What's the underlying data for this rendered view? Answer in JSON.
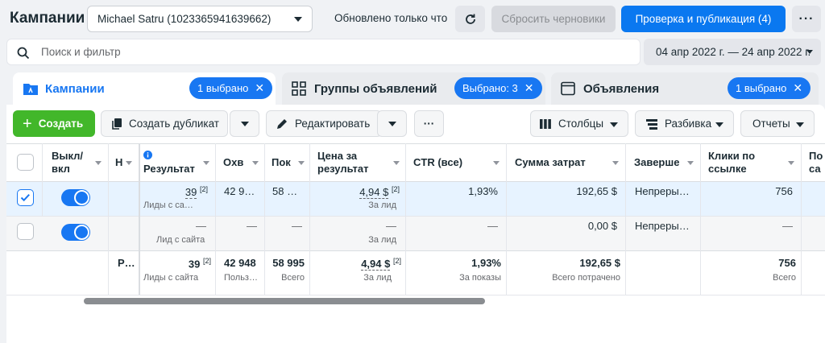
{
  "header": {
    "title": "Кампании",
    "account": "Michael Satru (1023365941639662)",
    "updated": "Обновлено только что",
    "discard_label": "Сбросить черновики",
    "publish_label": "Проверка и публикация (4)",
    "more_label": "···"
  },
  "search": {
    "placeholder": "Поиск и фильтр"
  },
  "date_range": "04 апр 2022 г. — 24 апр 2022 г.",
  "tabs": [
    {
      "label": "Кампании",
      "badge": "1 выбрано"
    },
    {
      "label": "Группы объявлений",
      "badge": "Выбрано: 3"
    },
    {
      "label": "Объявления",
      "badge": "1 выбрано"
    }
  ],
  "toolbar": {
    "create": "Создать",
    "duplicate": "Создать дубликат",
    "edit": "Редактировать",
    "more": "···",
    "columns": "Столбцы",
    "breakdown": "Разбивка",
    "reports": "Отчеты"
  },
  "table": {
    "headers": {
      "toggle": [
        "Выкл/",
        "вкл"
      ],
      "name": "Н",
      "result": "Результат",
      "reach": "Охв",
      "impressions": "Пок",
      "cost_per_result": [
        "Цена за",
        "результат"
      ],
      "ctr": "CTR (все)",
      "spent": "Сумма затрат",
      "ends": "Заверше",
      "link_clicks": [
        "Клики по",
        "ссылке"
      ],
      "last": [
        "По",
        "са"
      ]
    },
    "rows": [
      {
        "checked": true,
        "result": "39",
        "result_sup": "[2]",
        "result_sub": "Лиды с са…",
        "reach": "42 9…",
        "impressions": "58 …",
        "cpr": "4,94 $",
        "cpr_sup": "[2]",
        "cpr_sub": "За лид",
        "ctr": "1,93%",
        "spent": "192,65 $",
        "ends": "Непреры…",
        "clicks": "756"
      },
      {
        "checked": false,
        "result": "—",
        "result_sub": "Лид с сайта",
        "reach": "—",
        "impressions": "—",
        "cpr": "—",
        "cpr_sub": "За лид",
        "ctr": "—",
        "spent": "0,00 $",
        "ends": "Непреры…",
        "clicks": "—"
      }
    ],
    "totals": {
      "name": "Р…",
      "result": "39",
      "result_sup": "[2]",
      "result_sub": "Лиды с сайта",
      "reach": "42 948",
      "reach_sub": "Польз…",
      "impressions": "58 995",
      "impressions_sub": "Всего",
      "cpr": "4,94 $",
      "cpr_sup": "[2]",
      "cpr_sub": "За лид",
      "ctr": "1,93%",
      "ctr_sub": "За показы",
      "spent": "192,65 $",
      "spent_sub": "Всего потрачено",
      "clicks": "756",
      "clicks_sub": "Всего"
    }
  },
  "colors": {
    "primary": "#1877f2",
    "create": "#42b72a",
    "selected_row": "#e7f3ff"
  }
}
